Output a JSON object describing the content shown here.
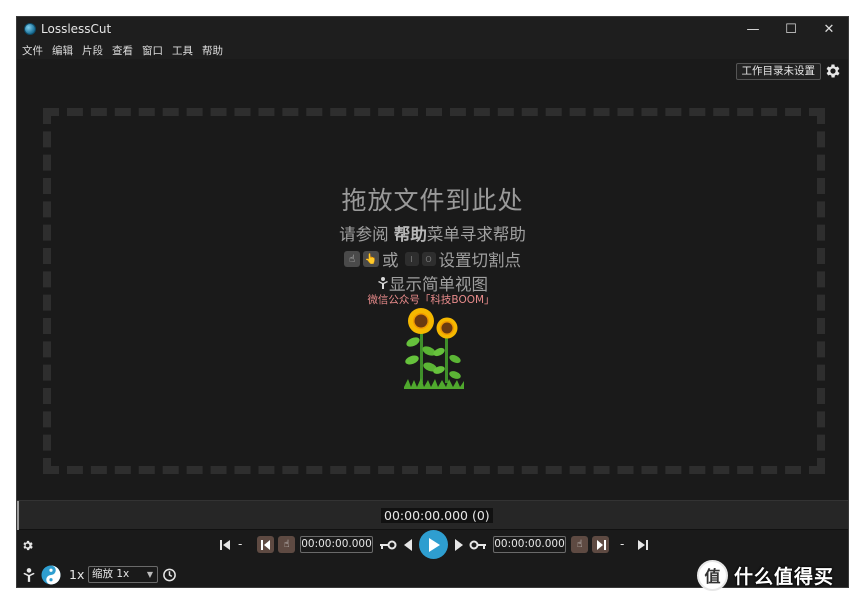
{
  "window": {
    "title": "LosslessCut",
    "controls": {
      "minimize": "—",
      "maximize": "☐",
      "close": "✕"
    }
  },
  "menu": {
    "items": [
      "文件",
      "编辑",
      "片段",
      "查看",
      "窗口",
      "工具",
      "帮助"
    ]
  },
  "toolbar": {
    "workdir_label": "工作目录未设置"
  },
  "dropzone": {
    "title": "拖放文件到此处",
    "help_prefix": "请参阅 ",
    "help_bold": "帮助",
    "help_suffix": "菜单寻求帮助",
    "cut_or": "或",
    "key_i": "I",
    "key_o": "O",
    "cut_suffix": "设置切割点",
    "simple_view": "显示简单视图"
  },
  "watermark": {
    "text": "微信公众号「科技BOOM」"
  },
  "timeline": {
    "current_time": "00:00:00.000 (0)"
  },
  "controls": {
    "start_dash": "-",
    "cut_start_time": "00:00:00.000",
    "cut_end_time": "00:00:00.000",
    "end_dash": "-"
  },
  "bottombar": {
    "rate": "1x",
    "zoom_value": "缩放 1x"
  },
  "badge": {
    "logo_char": "值",
    "text": "什么值得买"
  },
  "colors": {
    "background": "#1a1a1a",
    "accent_play": "#2e9ed0",
    "cut_button": "#5e4a42",
    "watermark": "#e88b8b"
  }
}
